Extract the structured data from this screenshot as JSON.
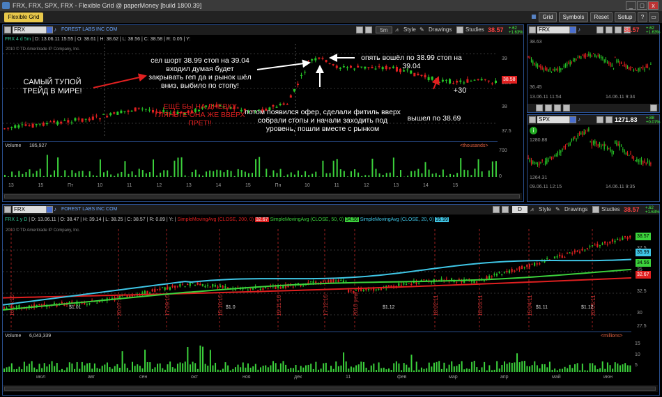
{
  "window": {
    "title": "FRX, FRX, SPX, FRX - Flexible Grid @ paperMoney [build 1800.39]"
  },
  "menu": {
    "tab": "Flexible Grid",
    "grid": "Grid",
    "symbols": "Symbols",
    "reset": "Reset",
    "setup": "Setup"
  },
  "p1": {
    "symbol": "FRX",
    "company": "FOREST LABS INC COM",
    "period": "5m",
    "style": "Style",
    "drawings": "Drawings",
    "studies": "Studies",
    "price": "38.57",
    "chg1": "+.62",
    "chg2": "+1.63%",
    "info": {
      "label": "FRX 4 d 5m",
      "d": "D: 13.06.11 15:55",
      "o": "O: 38.61",
      "h": "H: 38.62",
      "l": "L: 38.56",
      "c": "C: 38.58",
      "r": "R: 0.05",
      "y": "Y:"
    },
    "copyright": "2010 © TD Ameritrade IP Company, Inc.",
    "yaxis": [
      "39",
      "38.5",
      "38",
      "37.5"
    ],
    "last_tag": "38.58",
    "volume": {
      "label": "Volume",
      "value": "185,927",
      "units": "<thousands>",
      "ticks": [
        "700",
        "0"
      ]
    },
    "xaxis": [
      "13",
      "15",
      "Пт",
      "10",
      "11",
      "12",
      "13",
      "14",
      "15",
      "Пн",
      "10",
      "11",
      "12",
      "13",
      "14",
      "15"
    ],
    "annotations": {
      "a1": "САМЫЙ ТУПОЙ ТРЕЙД В МИРЕ!",
      "a2": "сел шорт 38.99 стоп на 39.04 входил думая будет закрывать геп да и рынок шёл вниз, выбило по стопу!",
      "a3": "ЕЩЁ БЫ НА ДНЕВКУ ГЛЯНЬТЕ ОНА ЖЕ ВВЕРХ ПРЕТ!!",
      "a4": "опять вошёл по 38.99 стоп на 39.04",
      "a5": "+30",
      "a6": "потом появился офер, сделали фитиль вверх собрали стопы и начали заходить под уровень, пошли вместе с рынком",
      "a7": "вышел по 38.69"
    }
  },
  "p2": {
    "symbol": "FRX",
    "price": "38.57",
    "chg1": "+.62",
    "chg2": "+1.63%",
    "yaxis": [
      "38.63",
      "36.45"
    ],
    "date": "13.06.11 11:54",
    "date2": "14.06.11 9:34"
  },
  "p3": {
    "symbol": "SPX",
    "price": "1271.83",
    "chg1": "+.88",
    "chg2": "+0.07%",
    "yaxis": [
      "1280.88",
      "1264.31"
    ],
    "date": "09.06.11 12:15",
    "date2": "14.06.11 9:35"
  },
  "p4": {
    "symbol": "FRX",
    "company": "FOREST LABS INC COM",
    "period": "D",
    "style": "Style",
    "drawings": "Drawings",
    "studies": "Studies",
    "price": "38.57",
    "chg1": "+.62",
    "chg2": "+1.63%",
    "info": {
      "label": "FRX 1 y D",
      "d": "D: 13.06.11",
      "o": "O: 38.47",
      "h": "H: 39.14",
      "l": "L: 38.25",
      "c": "C: 38.57",
      "r": "R: 0.89",
      "y": "Y:"
    },
    "sma200": "SimpleMovingAvg (CLOSE, 200, 0)",
    "sma200v": "32.67",
    "sma50": "SimpleMovingAvg (CLOSE, 50, 0)",
    "sma50v": "34.56",
    "sma20": "SimpleMovingAvg (CLOSE, 20, 0)",
    "sma20v": "35.99",
    "copyright": "2010 © TD Ameritrade IP Company, Inc.",
    "yaxis": [
      "37.5",
      "35",
      "32.5",
      "30",
      "27.5"
    ],
    "tags": {
      "last": "38.57",
      "s20": "35.99",
      "s50": "34.56",
      "s200": "32.67"
    },
    "volume": {
      "label": "Volume",
      "value": "6,043,339",
      "units": "<millions>",
      "ticks": [
        "15",
        "10",
        "5"
      ]
    },
    "xaxis": [
      "июл",
      "авг",
      "сен",
      "окт",
      "ноя",
      "дек",
      "11",
      "фев",
      "мар",
      "апр",
      "май",
      "июн"
    ],
    "vdates": [
      "16.06.10",
      "20.07.10",
      "17.09.10",
      "15.10.10",
      "19.11.10",
      "17.12.10",
      "2010 year",
      "18.02.11",
      "18.03.11",
      "15.04.11",
      "20.05.11"
    ],
    "divs": [
      "$1.01",
      "$1.0",
      "$1.12",
      "$1.11",
      "$1.12"
    ]
  },
  "colors": {
    "accent": "#2a4f8f",
    "up": "#26c626",
    "down": "#e02020",
    "sma200": "#e02020",
    "sma50": "#3cd23c",
    "sma20": "#3fc6e6"
  }
}
